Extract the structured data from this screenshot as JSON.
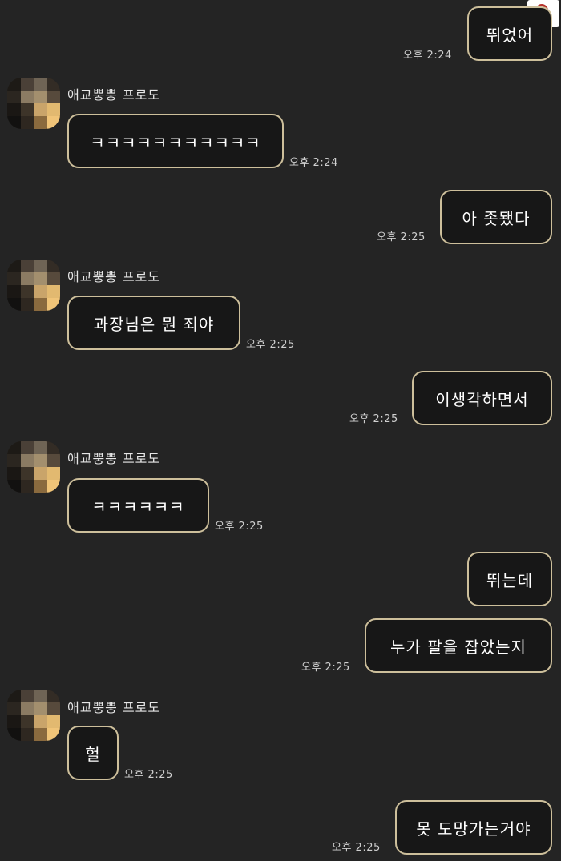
{
  "messages": {
    "out_1": {
      "text": "뛰었어",
      "time": "오후 2:24"
    },
    "in_1_name": "애교뿡뿡 프로도",
    "in_1": {
      "text": "ㅋㅋㅋㅋㅋㅋㅋㅋㅋㅋㅋ",
      "time": "오후 2:24"
    },
    "out_2": {
      "text": "아 좃됐다",
      "time": "오후 2:25"
    },
    "in_2_name": "애교뿡뿡 프로도",
    "in_2": {
      "text": "과장님은 뭔 죄야",
      "time": "오후 2:25"
    },
    "out_3": {
      "text": "이생각하면서",
      "time": "오후 2:25"
    },
    "in_3_name": "애교뿡뿡 프로도",
    "in_3": {
      "text": "ㅋㅋㅋㅋㅋㅋ",
      "time": "오후 2:25"
    },
    "out_4a": {
      "text": "뛰는데"
    },
    "out_4b": {
      "text": "누가 팔을 잡았는지",
      "time": "오후 2:25"
    },
    "in_4_name": "애교뿡뿡 프로도",
    "in_4": {
      "text": "헐",
      "time": "오후 2:25"
    },
    "out_5": {
      "text": "못 도망가는거야",
      "time": "오후 2:25"
    }
  },
  "icons": {
    "search": "search-icon",
    "avatar": "blurred-avatar"
  },
  "colors": {
    "background": "#242424",
    "bubble_border": "#cdbf9b",
    "bubble_fill": "#171717",
    "search_accent": "#b8322d"
  }
}
